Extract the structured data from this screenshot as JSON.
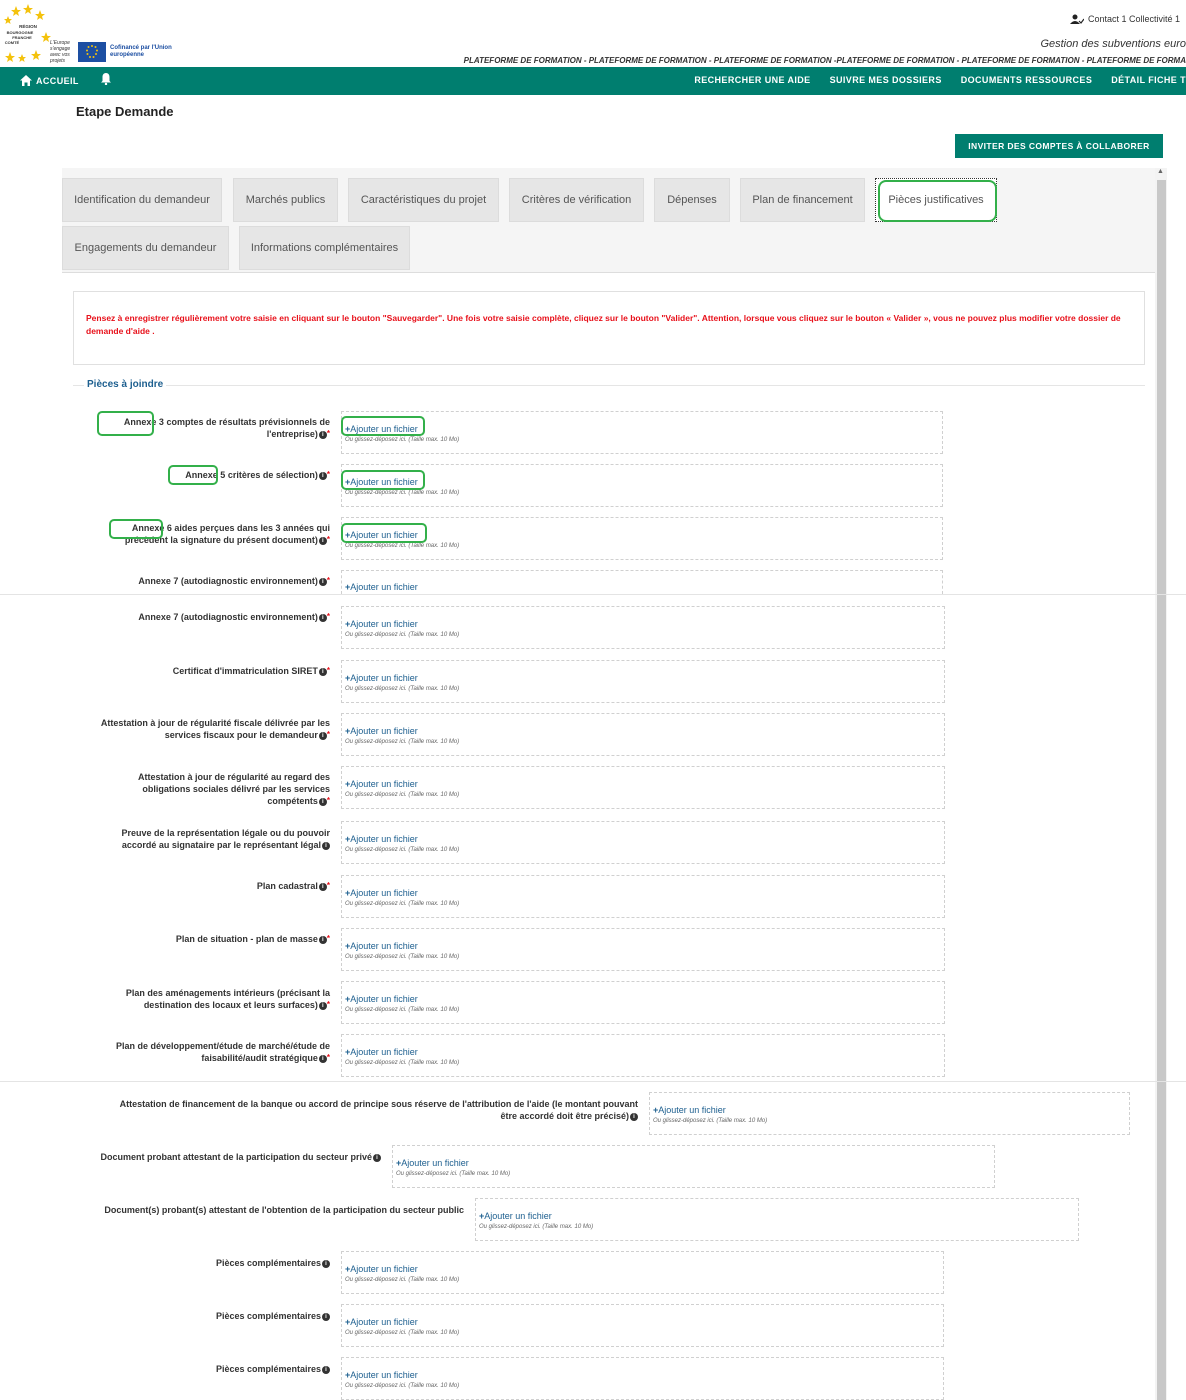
{
  "header": {
    "user_name": "Contact 1 Collectivité 1",
    "app_title": "Gestion des subventions euro",
    "platform_line": "PLATEFORME DE FORMATION - PLATEFORME DE FORMATION - PLATEFORME DE FORMATION -PLATEFORME DE FORMATION - PLATEFORME DE FORMATION - PLATEFORME DE FORMA",
    "eu_small": "L'Europe s'engage avec vos projets",
    "eu_cofinance": "Cofinancé par l'Union européenne",
    "logo_text": "RÉGION BOURGOGNE FRANCHE COMTÉ"
  },
  "nav": {
    "home": "ACCUEIL",
    "links": [
      "RECHERCHER UNE AIDE",
      "SUIVRE MES DOSSIERS",
      "DOCUMENTS RESSOURCES",
      "DÉTAIL FICHE T"
    ]
  },
  "page": {
    "title": "Etape Demande",
    "invite_button": "INVITER DES COMPTES À COLLABORER"
  },
  "tabs": [
    "Identification du demandeur",
    "Marchés publics",
    "Caractéristiques du projet",
    "Critères de vérification",
    "Dépenses",
    "Plan de financement",
    "Pièces justificatives",
    "Engagements du demandeur",
    "Informations complémentaires"
  ],
  "warning": "Pensez à enregistrer régulièrement votre saisie en cliquant sur le bouton \"Sauvegarder\". Une fois votre saisie complète, cliquez sur le bouton \"Valider\". Attention, lorsque vous cliquez sur le bouton « Valider », vous ne pouvez plus modifier votre dossier de demande d'aide .",
  "section_title": "Pièces à joindre",
  "add_file": "Ajouter un fichier",
  "drop_hint": "Ou glissez-déposez ici. (Taille max. 10 Mo)",
  "documents": {
    "annexe3_a": "Annexe 3",
    "annexe3_b": "comptes de résultats prévisionnels de",
    "annexe3_c": "l'entreprise)",
    "annexe5_a": "Annexe 5",
    "annexe5_b": "critères de sélection)",
    "annexe6_a": "Annexe 6",
    "annexe6_b": "aides perçues dans les 3 années qui",
    "annexe6_c": "précèdent la signature du présent document)",
    "annexe7": "Annexe 7 (autodiagnostic environnement)",
    "siret": "Certificat d'immatriculation SIRET",
    "fiscal_a": "Attestation à jour de régularité fiscale délivrée par les",
    "fiscal_b": "services fiscaux pour le demandeur",
    "social_a": "Attestation à jour de régularité au regard des",
    "social_b": "obligations sociales délivré par les services",
    "social_c": "compétents",
    "legal_a": "Preuve de la représentation légale ou du pouvoir",
    "legal_b": "accordé au signataire par le représentant légal",
    "cadastral": "Plan cadastral",
    "situation": "Plan de situation - plan de masse",
    "amenag_a": "Plan des aménagements intérieurs (précisant la",
    "amenag_b": "destination des locaux et leurs surfaces)",
    "dev_a": "Plan de développement/étude de marché/étude de",
    "dev_b": "faisabilité/audit stratégique",
    "bank_a": "Attestation de financement de la banque ou accord de principe sous réserve de l'attribution de l'aide (le montant pouvant",
    "bank_b": "être accordé doit être précisé)",
    "prive": "Document probant attestant de la participation du secteur privé",
    "public": "Document(s) probant(s) attestant de l'obtention de la participation du secteur public",
    "compl": "Pièces complémentaires"
  }
}
